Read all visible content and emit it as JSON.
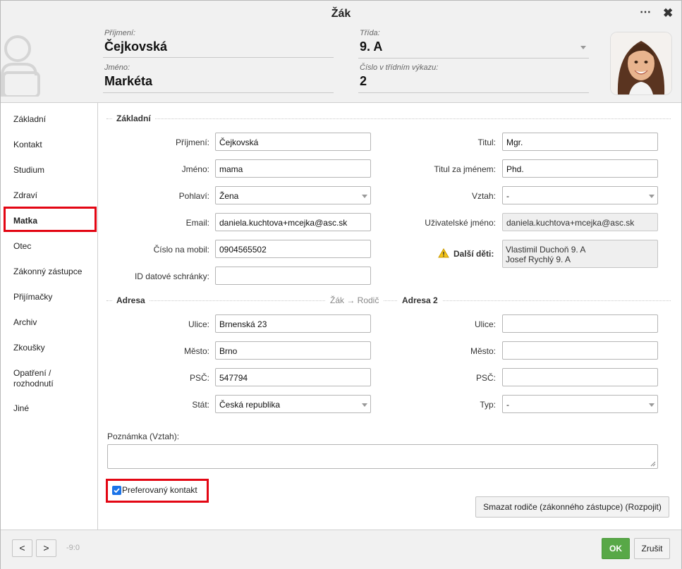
{
  "title": "Žák",
  "window_controls": {
    "more": "⋯",
    "close": "✖"
  },
  "header": {
    "surname_label": "Příjmení:",
    "surname": "Čejkovská",
    "firstname_label": "Jméno:",
    "firstname": "Markéta",
    "class_label": "Třída:",
    "class_value": "9. A",
    "class_number_label": "Číslo v třídním výkazu:",
    "class_number": "2"
  },
  "sidebar": {
    "items": [
      "Základní",
      "Kontakt",
      "Studium",
      "Zdraví",
      "Matka",
      "Otec",
      "Zákonný zástupce",
      "Přijímačky",
      "Archiv",
      "Zkoušky",
      "Opatření / rozhodnutí",
      "Jiné"
    ],
    "active": "Matka"
  },
  "basic": {
    "section_title": "Základní",
    "surname_label": "Příjmení:",
    "surname": "Čejkovská",
    "firstname_label": "Jméno:",
    "firstname": "mama",
    "gender_label": "Pohlaví:",
    "gender": "Žena",
    "email_label": "Email:",
    "email": "daniela.kuchtova+mcejka@asc.sk",
    "mobile_label": "Číslo na mobil:",
    "mobile": "0904565502",
    "databox_label": "ID datové schránky:",
    "databox": "",
    "title_label": "Titul:",
    "title_value": "Mgr.",
    "title_after_label": "Titul za jménem:",
    "title_after": "Phd.",
    "relation_label": "Vztah:",
    "relation": "-",
    "username_label": "Uživatelské jméno:",
    "username": "daniela.kuchtova+mcejka@asc.sk",
    "other_children_label": "Další děti:",
    "other_children": [
      "Vlastimil Duchoň 9. A",
      "Josef Rychlý 9. A"
    ]
  },
  "address": {
    "section_title": "Adresa",
    "copy_link": "Žák → Rodič",
    "street_label": "Ulice:",
    "street": "Brnenská 23",
    "city_label": "Město:",
    "city": "Brno",
    "zip_label": "PSČ:",
    "zip": "547794",
    "country_label": "Stát:",
    "country": "Česká republika"
  },
  "address2": {
    "section_title": "Adresa 2",
    "street_label": "Ulice:",
    "street": "",
    "city_label": "Město:",
    "city": "",
    "zip_label": "PSČ:",
    "zip": "",
    "type_label": "Typ:",
    "type": "-"
  },
  "note": {
    "label": "Poznámka (Vztah):",
    "value": ""
  },
  "preferred_contact": {
    "label": "Preferovaný kontakt",
    "checked": true
  },
  "delete_button": "Smazat rodiče (zákonného zástupce) (Rozpojit)",
  "footer": {
    "prev": "<",
    "next": ">",
    "status": "-9:0",
    "ok": "OK",
    "cancel": "Zrušit"
  },
  "colors": {
    "highlight": "#e30613",
    "ok_button": "#58a847",
    "checkbox": "#1a73e8"
  }
}
